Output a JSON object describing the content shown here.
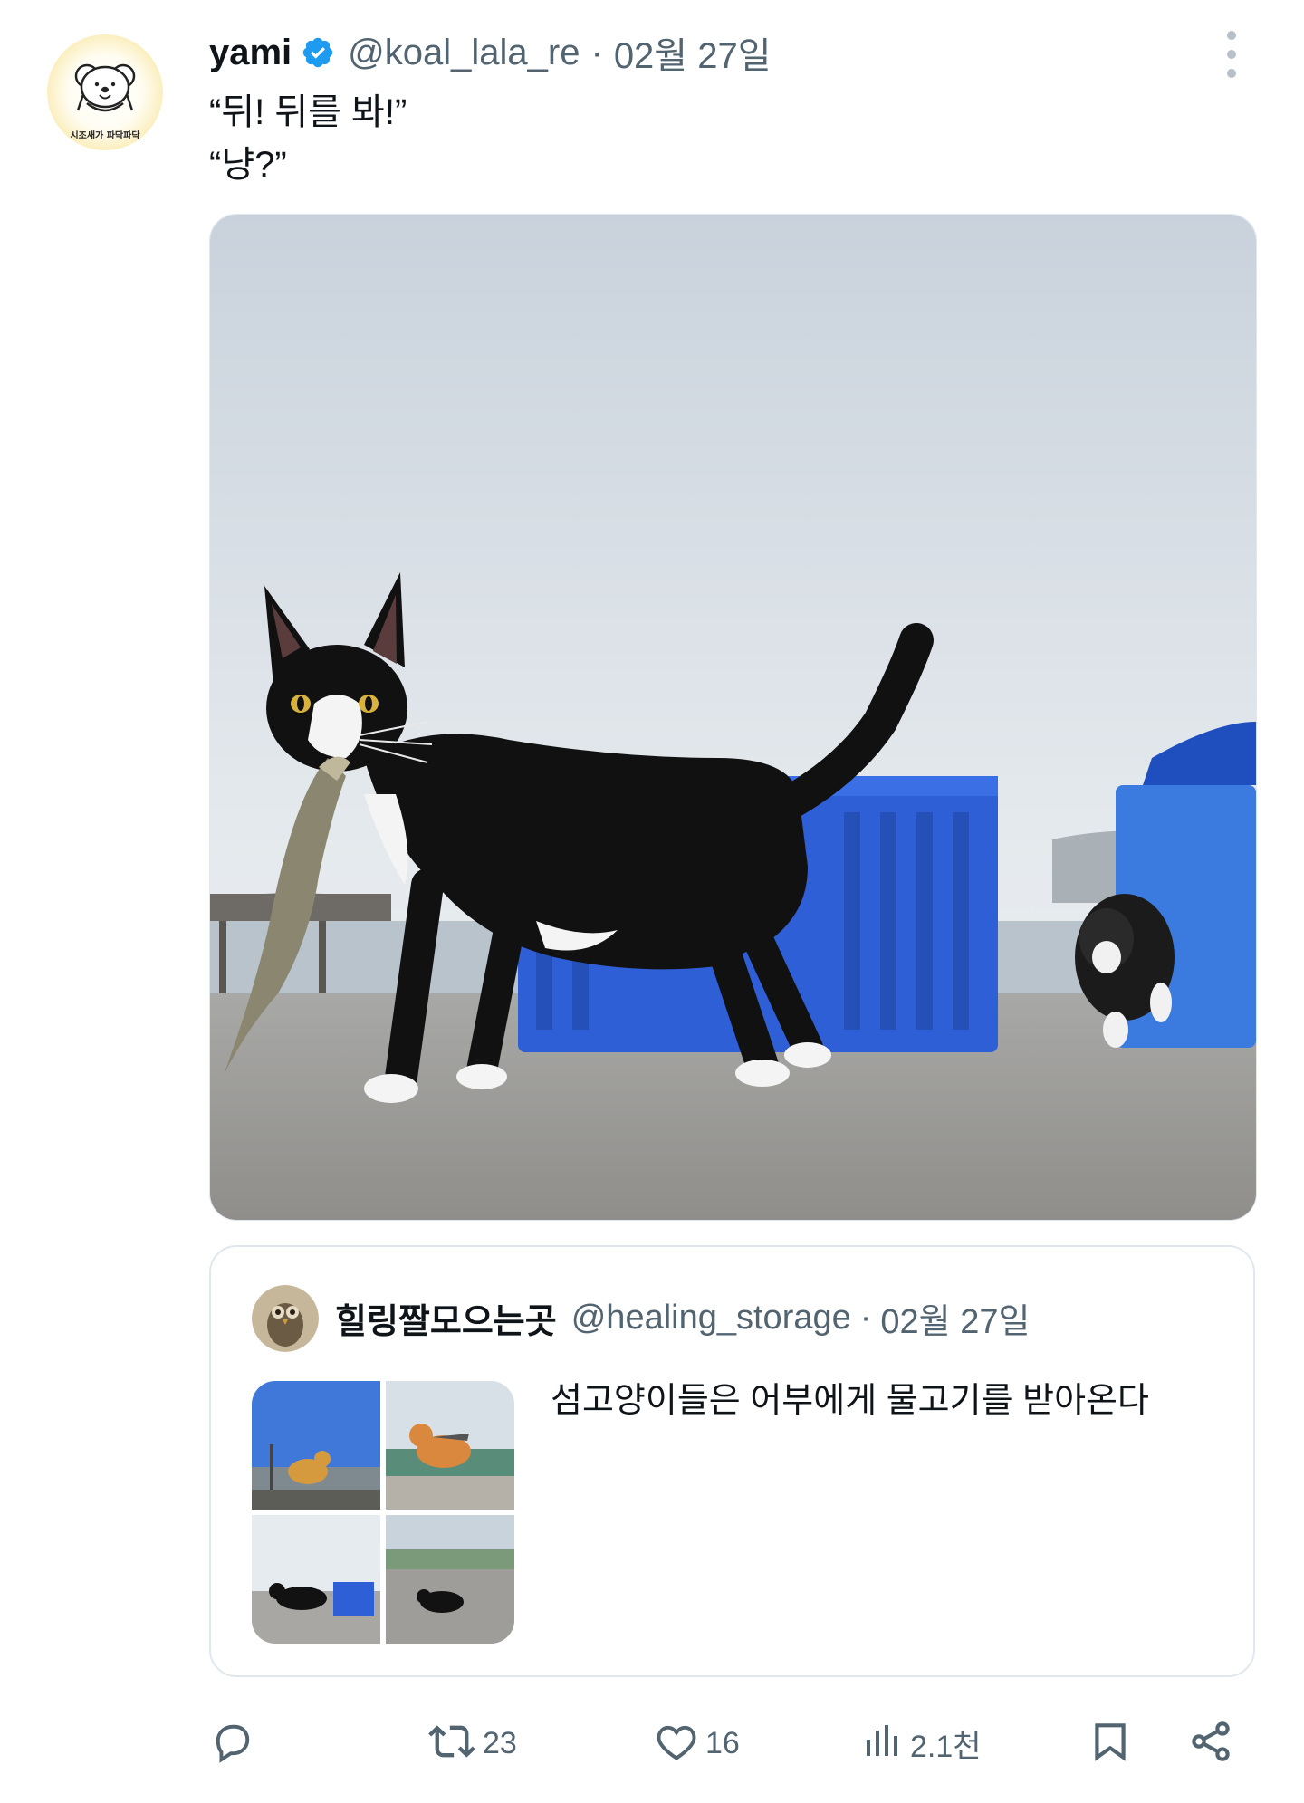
{
  "tweet": {
    "display_name": "yami",
    "handle": "@koal_lala_re",
    "separator": "·",
    "date": "02월 27일",
    "text_lines": [
      "“뒤! 뒤를 봐!”",
      "“냥?”"
    ],
    "avatar_caption": "시조새가 파닥파닥"
  },
  "quoted": {
    "display_name": "힐링짤모으는곳",
    "handle": "@healing_storage",
    "separator": "·",
    "date": "02월 27일",
    "text": "섬고양이들은 어부에게 물고기를 받아온다"
  },
  "actions": {
    "reply_count": "",
    "retweet_count": "23",
    "like_count": "16",
    "views_count": "2.1천"
  },
  "colors": {
    "verified_blue": "#1d9bf0",
    "secondary_text": "#536471",
    "basket_blue": "#2f5fd6"
  },
  "icons": {
    "reply": "speech-bubble-icon",
    "retweet": "retweet-icon",
    "like": "heart-icon",
    "views": "bar-chart-icon",
    "bookmark": "bookmark-icon",
    "share": "share-icon",
    "more": "vertical-dots-icon",
    "verified": "verified-badge-icon"
  }
}
